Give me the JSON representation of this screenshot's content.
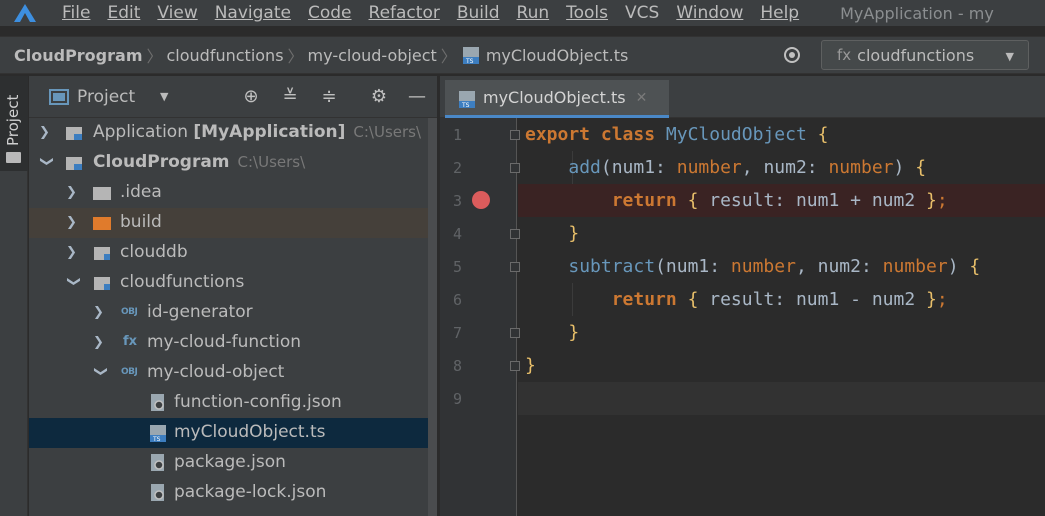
{
  "menubar": {
    "items": [
      {
        "label": "File"
      },
      {
        "label": "Edit"
      },
      {
        "label": "View"
      },
      {
        "label": "Navigate"
      },
      {
        "label": "Code"
      },
      {
        "label": "Refactor"
      },
      {
        "label": "Build"
      },
      {
        "label": "Run"
      },
      {
        "label": "Tools"
      },
      {
        "label": "VCS"
      },
      {
        "label": "Window"
      },
      {
        "label": "Help"
      }
    ],
    "app_title": "MyApplication - my"
  },
  "breadcrumb": {
    "items": [
      "CloudProgram",
      "cloudfunctions",
      "my-cloud-object",
      "myCloudObject.ts"
    ]
  },
  "run_target": {
    "label": "cloudfunctions"
  },
  "toolstrip": {
    "project_tab": "Project"
  },
  "project_panel": {
    "title": "Project",
    "tree": [
      {
        "label": "Application",
        "bold": "[MyApplication]",
        "hint": "C:\\Users\\"
      },
      {
        "label": "CloudProgram",
        "hint": "C:\\Users\\"
      },
      {
        "label": ".idea"
      },
      {
        "label": "build"
      },
      {
        "label": "clouddb"
      },
      {
        "label": "cloudfunctions"
      },
      {
        "label": "id-generator"
      },
      {
        "label": "my-cloud-function"
      },
      {
        "label": "my-cloud-object"
      },
      {
        "label": "function-config.json"
      },
      {
        "label": "myCloudObject.ts"
      },
      {
        "label": "package.json"
      },
      {
        "label": "package-lock.json"
      }
    ]
  },
  "editor": {
    "tab_label": "myCloudObject.ts",
    "line_numbers": [
      "1",
      "2",
      "3",
      "4",
      "5",
      "6",
      "7",
      "8",
      "9"
    ],
    "code": {
      "l1": {
        "kw1": "export",
        "kw2": "class",
        "cls": "MyCloudObject",
        "br": "{"
      },
      "l2": {
        "fn": "add",
        "p1": "(num1: ",
        "t1": "number",
        "p2": ", num2: ",
        "t2": "number",
        "p3": ") ",
        "br": "{"
      },
      "l3": {
        "kw": "return",
        "br1": "{",
        "body": " result: num1 + num2 ",
        "br2": "}",
        "end": ";"
      },
      "l4": {
        "br": "}"
      },
      "l5": {
        "fn": "subtract",
        "p1": "(num1: ",
        "t1": "number",
        "p2": ", num2: ",
        "t2": "number",
        "p3": ") ",
        "br": "{"
      },
      "l6": {
        "kw": "return",
        "br1": "{",
        "body": " result: num1 - num2 ",
        "br2": "}",
        "end": ";"
      },
      "l7": {
        "br": "}"
      },
      "l8": {
        "br": "}"
      }
    }
  },
  "colors": {
    "keyword": "#cc7832",
    "brace": "#e8bf6a",
    "selection": "#0d293e",
    "breakpoint": "#db5c5c"
  }
}
